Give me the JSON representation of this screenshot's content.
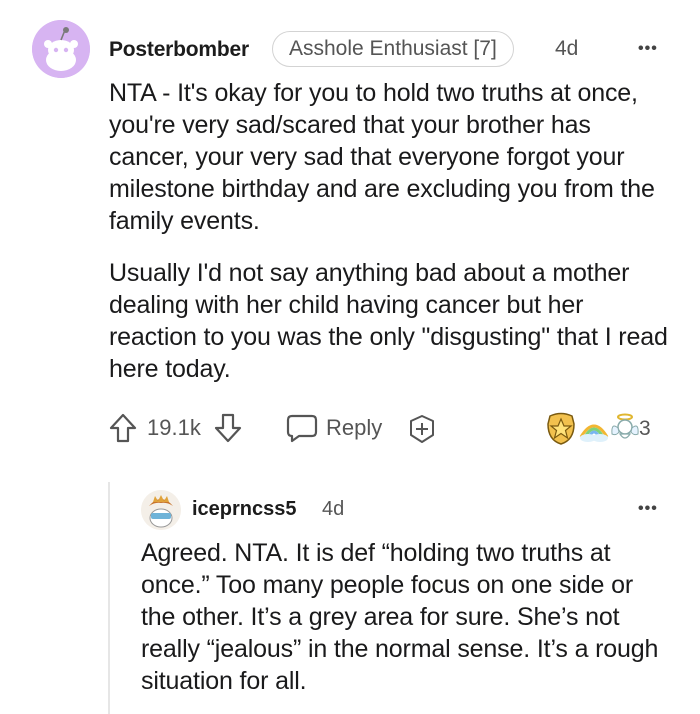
{
  "comment": {
    "username": "Posterbomber",
    "flair": "Asshole Enthusiast [7]",
    "age": "4d",
    "more_label": "•••",
    "paragraphs": [
      "NTA - It's okay for you to hold two truths at once, you're very sad/scared that your brother has cancer, your very sad that everyone forgot your milestone birthday and are excluding you from the family events.",
      "Usually I'd not say anything bad about a mother dealing with her child having cancer but her reaction to you was the only \"disgusting\" that I read here today."
    ],
    "score": "19.1k",
    "reply_label": "Reply",
    "award_count": "3",
    "icons": [
      "upvote-icon",
      "downvote-icon",
      "reply-bubble-icon",
      "award-plus-icon",
      "gold-award-icon",
      "rainbow-award-icon",
      "angel-award-icon"
    ]
  },
  "reply": {
    "username": "iceprncss5",
    "age": "4d",
    "more_label": "•••",
    "text": "Agreed. NTA. It is def “holding two truths at once.” Too many people focus on one side or the other. It’s a grey area for sure. She’s not really “jealous” in the normal sense. It’s a rough situation for all."
  },
  "colors": {
    "avatar_bg": "#d7b4f2",
    "text": "#1a1a1b",
    "meta": "#555555",
    "award_gold": "#f2c14e"
  }
}
